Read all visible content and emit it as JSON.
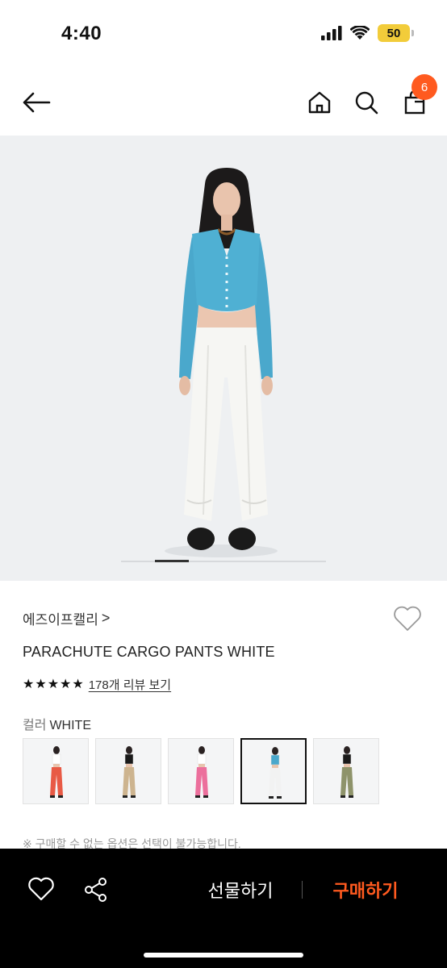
{
  "status_bar": {
    "time": "4:40",
    "battery": "50",
    "icons": [
      "cellular-signal-icon",
      "wifi-icon",
      "battery-icon"
    ]
  },
  "nav": {
    "icons": [
      "back-arrow-icon",
      "home-icon",
      "search-icon",
      "shopping-bag-icon"
    ],
    "cart_count": "6"
  },
  "hero": {
    "image": "model-wearing-blue-cardigan-and-white-parachute-pants",
    "page_indicator": {
      "current": 2,
      "total": 6
    }
  },
  "product": {
    "brand": "에즈이프캘리",
    "brand_chevron": ">",
    "title": "PARACHUTE CARGO PANTS WHITE",
    "rating_stars": 5,
    "review_link": "178개 리뷰 보기",
    "color_label": "컬러",
    "color_value": "WHITE",
    "color_options": [
      {
        "name": "red",
        "pants": "#e85a45",
        "top": "#ffffff",
        "selected": false
      },
      {
        "name": "beige",
        "pants": "#cdb48f",
        "top": "#1a1a1a",
        "selected": false
      },
      {
        "name": "pink",
        "pants": "#ec6f9c",
        "top": "#ffffff",
        "selected": false
      },
      {
        "name": "white",
        "pants": "#f2f2f2",
        "top": "#4aa8cc",
        "selected": true
      },
      {
        "name": "khaki",
        "pants": "#8e936a",
        "top": "#1a1a1a",
        "selected": false
      }
    ],
    "notice": "※ 구매할 수 없는 옵션은 선택이 불가능합니다."
  },
  "bottom_bar": {
    "icons": [
      "heart-outline-icon",
      "share-icon"
    ],
    "gift_label": "선물하기",
    "buy_label": "구매하기"
  },
  "colors": {
    "accent": "#ff5a1f",
    "bottom_bar_bg": "#000000",
    "hero_bg": "#eef0f2"
  }
}
